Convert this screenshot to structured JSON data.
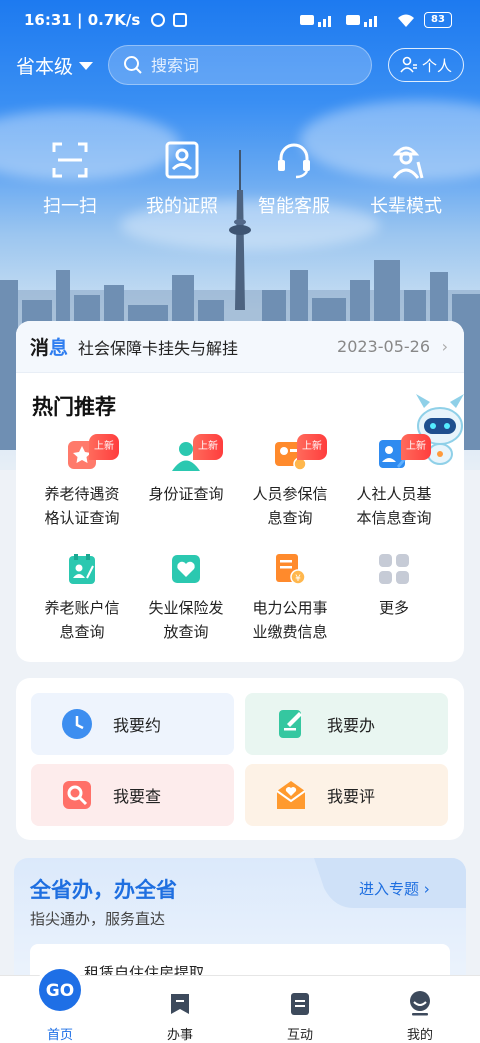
{
  "status": {
    "time": "16:31",
    "speed": "0.7K/s",
    "battery": "83"
  },
  "header": {
    "region": "省本级",
    "search_placeholder": "搜索词",
    "personal": "个人"
  },
  "quick": [
    {
      "label": "扫一扫"
    },
    {
      "label": "我的证照"
    },
    {
      "label": "智能客服"
    },
    {
      "label": "长辈模式"
    }
  ],
  "message": {
    "tag_a": "消",
    "tag_b": "息",
    "text": "社会保障卡挂失与解挂",
    "date": "2023-05-26"
  },
  "hot": {
    "title": "热门推荐",
    "new_badge": "上新",
    "items": [
      {
        "l1": "养老待遇资",
        "l2": "格认证查询"
      },
      {
        "l1": "身份证查询",
        "l2": ""
      },
      {
        "l1": "人员参保信",
        "l2": "息查询"
      },
      {
        "l1": "人社人员基",
        "l2": "本信息查询"
      },
      {
        "l1": "养老账户信",
        "l2": "息查询"
      },
      {
        "l1": "失业保险发",
        "l2": "放查询"
      },
      {
        "l1": "电力公用事",
        "l2": "业缴费信息"
      },
      {
        "l1": "更多",
        "l2": ""
      }
    ]
  },
  "actions": [
    {
      "label": "我要约"
    },
    {
      "label": "我要办"
    },
    {
      "label": "我要查"
    },
    {
      "label": "我要评"
    }
  ],
  "banner": {
    "title": "全省办，办全省",
    "subtitle": "指尖通办，服务直达",
    "link": "进入专题",
    "peek": "租赁自住住房提取"
  },
  "nav": [
    {
      "label": "首页"
    },
    {
      "label": "办事"
    },
    {
      "label": "互动"
    },
    {
      "label": "我的"
    }
  ],
  "colors": {
    "accent": "#2f7ef0",
    "badge": "#ff3d3d"
  }
}
